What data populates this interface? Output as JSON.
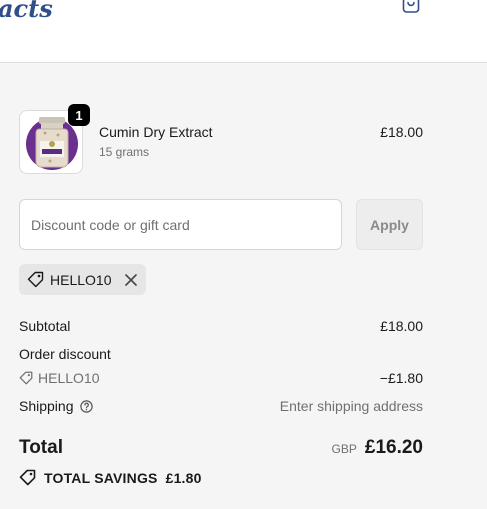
{
  "header": {
    "logo_text": "acts",
    "cart_icon": "shopping-bag-icon"
  },
  "product": {
    "title": "Cumin Dry Extract",
    "variant": "15 grams",
    "price": "£18.00",
    "quantity": "1"
  },
  "discount": {
    "placeholder": "Discount code or gift card",
    "value": "",
    "apply_label": "Apply",
    "applied_code": "HELLO10"
  },
  "totals": {
    "subtotal_label": "Subtotal",
    "subtotal_value": "£18.00",
    "order_discount_label": "Order discount",
    "discount_code": "HELLO10",
    "discount_value": "−£1.80",
    "shipping_label": "Shipping",
    "shipping_value": "Enter shipping address",
    "total_label": "Total",
    "currency": "GBP",
    "total_value": "£16.20",
    "savings_label": "TOTAL SAVINGS",
    "savings_value": "£1.80"
  },
  "colors": {
    "accent": "#2f4f8a",
    "badge": "#000000",
    "muted_text": "#707070"
  }
}
